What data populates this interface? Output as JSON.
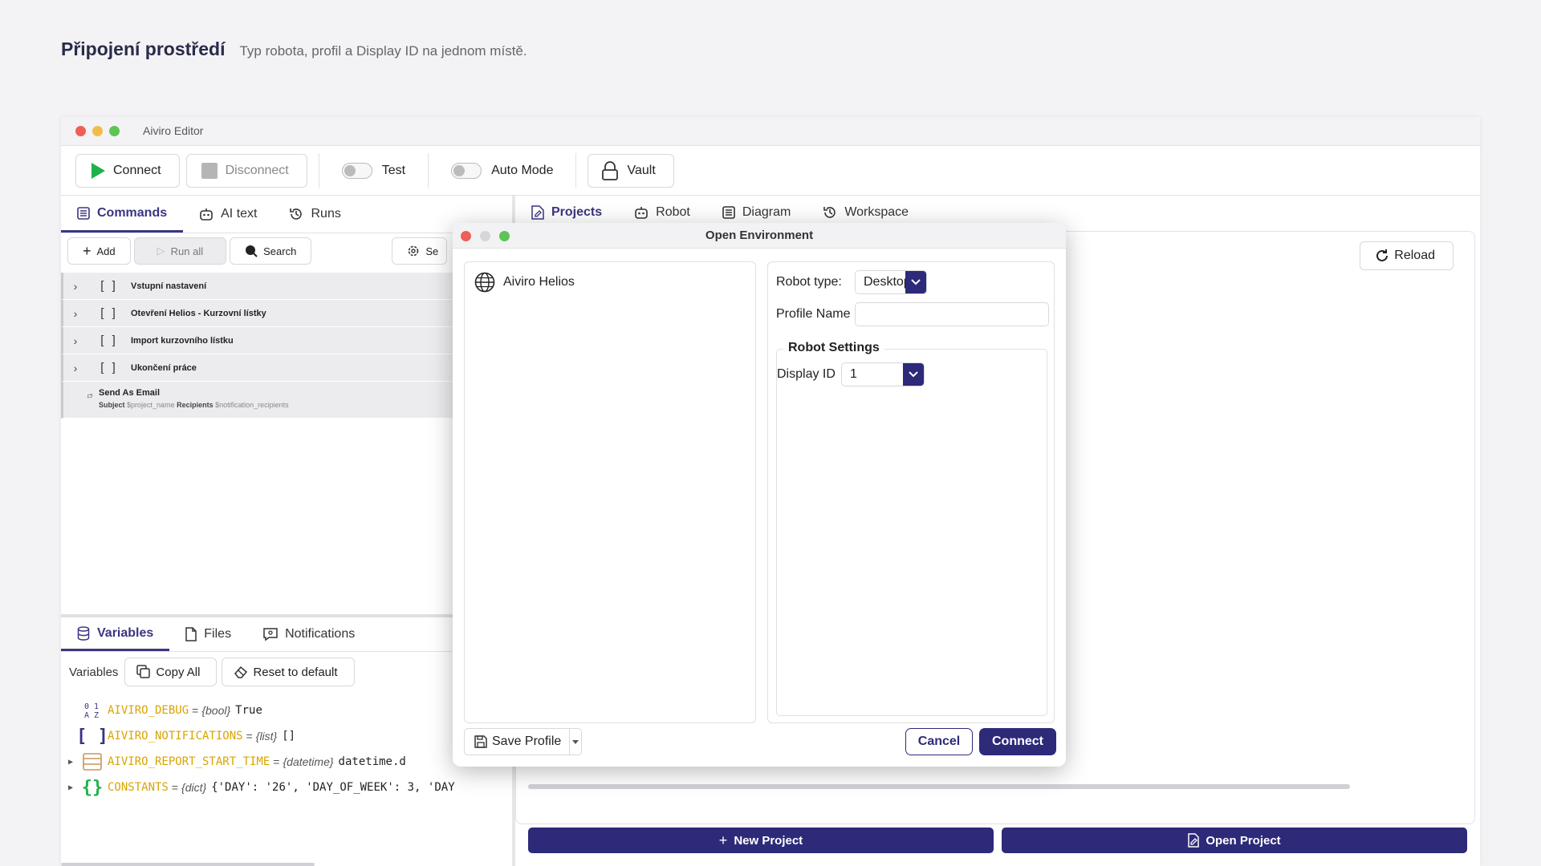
{
  "page": {
    "title": "Připojení prostředí",
    "subtitle": "Typ robota, profil a Display ID na jednom místě."
  },
  "window": {
    "title": "Aiviro Editor"
  },
  "toolbar": {
    "connect": "Connect",
    "disconnect": "Disconnect",
    "test": "Test",
    "auto_mode": "Auto Mode",
    "vault": "Vault"
  },
  "left_tabs": [
    "Commands",
    "AI text",
    "Runs"
  ],
  "right_tabs": [
    "Projects",
    "Robot",
    "Diagram",
    "Workspace"
  ],
  "commands_bar": {
    "add": "Add",
    "run_all": "Run all",
    "search": "Search",
    "settings": "Se"
  },
  "commands": [
    "Vstupní nastavení",
    "Otevření Helios - Kurzovní lístky",
    "Import kurzovního lístku",
    "Ukončení práce"
  ],
  "email_command": {
    "title": "Send As Email",
    "subject_label": "Subject",
    "subject_value": "$project_name",
    "recipients_label": "Recipients",
    "recipients_value": "$notification_recipients"
  },
  "bottom_tabs": [
    "Variables",
    "Files",
    "Notifications"
  ],
  "variables_bar": {
    "label": "Variables",
    "copy_all": "Copy All",
    "reset": "Reset to default"
  },
  "variables": [
    {
      "name": "AIVIRO_DEBUG",
      "type": "{bool}",
      "value": "True"
    },
    {
      "name": "AIVIRO_NOTIFICATIONS",
      "type": "{list}",
      "value": "[]"
    },
    {
      "name": "AIVIRO_REPORT_START_TIME",
      "type": "{datetime}",
      "value": "datetime.d"
    },
    {
      "name": "CONSTANTS",
      "type": "{dict}",
      "value": "{'DAY': '26', 'DAY_OF_WEEK': 3, 'DAY"
    }
  ],
  "projects": {
    "reload": "Reload",
    "new_project": "New Project",
    "open_project": "Open Project"
  },
  "modal": {
    "title": "Open Environment",
    "profiles": [
      "Aiviro Helios"
    ],
    "robot_type_label": "Robot type:",
    "robot_type_value": "Desktop",
    "profile_name_label": "Profile Name",
    "profile_name_value": "",
    "robot_settings_label": "Robot Settings",
    "display_id_label": "Display ID",
    "display_id_value": "1",
    "save_profile": "Save Profile",
    "cancel": "Cancel",
    "connect": "Connect"
  },
  "colors": {
    "accent": "#2d2a7a",
    "var_name": "#d9a400",
    "play": "#1fb14a"
  }
}
